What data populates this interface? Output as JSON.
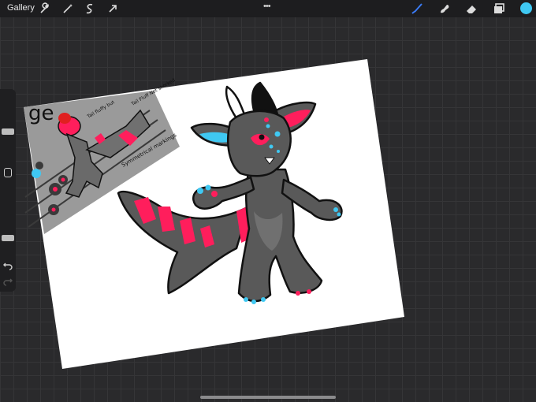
{
  "toolbar": {
    "gallery_label": "Gallery",
    "left_tools": [
      "wrench-icon",
      "magic-wand-icon",
      "selection-icon",
      "transform-arrow-icon"
    ],
    "more_label": "•••",
    "right_tools": [
      "brush-icon",
      "smudge-icon",
      "eraser-icon",
      "layers-icon"
    ],
    "active_tool": "brush-icon",
    "active_tool_color": "#3a7bf5",
    "current_color": "#3fc8f2"
  },
  "sidebar": {
    "controls": [
      "brush-size-slider",
      "modify-button",
      "opacity-slider",
      "undo-icon",
      "redo-icon"
    ],
    "redo_enabled": false
  },
  "artwork": {
    "reference_sheet_text": [
      "ge",
      "Tail fluffy but",
      "Tail Fluff Not shorked",
      "Symmetrical markings"
    ],
    "colors": {
      "fur": "#595959",
      "accent_pink": "#ff1e5c",
      "accent_blue": "#3fc8f2",
      "outline": "#111111"
    }
  }
}
